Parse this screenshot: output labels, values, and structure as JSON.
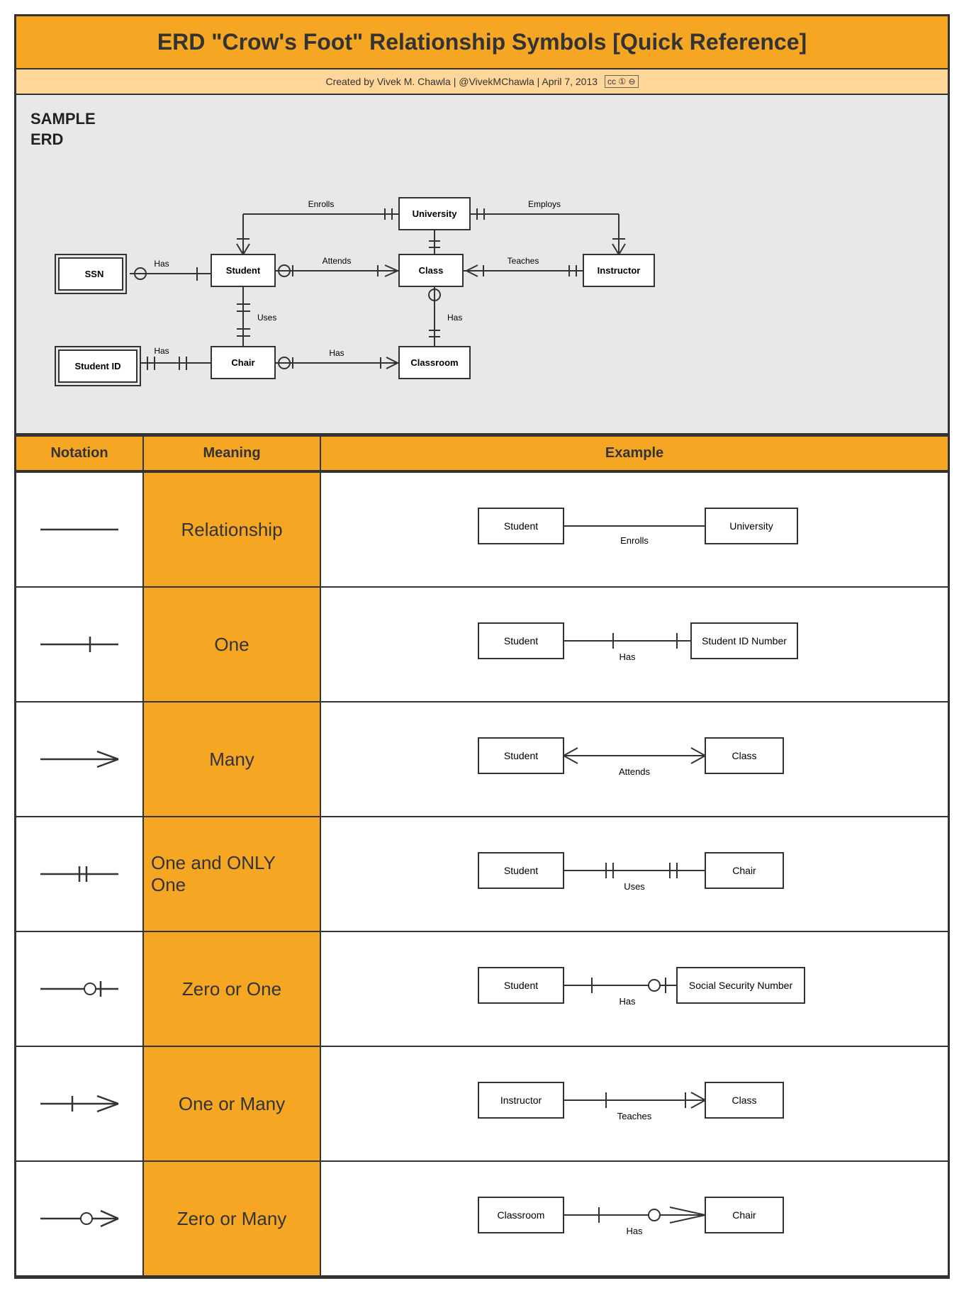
{
  "title": "ERD \"Crow's Foot\" Relationship Symbols [Quick Reference]",
  "credit": "Created by Vivek M. Chawla  |  @VivekMChawla  |  April 7, 2013",
  "erd_label": "SAMPLE\nERD",
  "header": {
    "notation": "Notation",
    "meaning": "Meaning",
    "example": "Example"
  },
  "rows": [
    {
      "meaning": "Relationship",
      "left_entity": "Student",
      "right_entity": "University",
      "rel_label": "Enrolls",
      "symbol": "plain"
    },
    {
      "meaning": "One",
      "left_entity": "Student",
      "right_entity": "Student ID Number",
      "rel_label": "Has",
      "symbol": "one"
    },
    {
      "meaning": "Many",
      "left_entity": "Student",
      "right_entity": "Class",
      "rel_label": "Attends",
      "symbol": "many"
    },
    {
      "meaning": "One and ONLY One",
      "left_entity": "Student",
      "right_entity": "Chair",
      "rel_label": "Uses",
      "symbol": "one-only"
    },
    {
      "meaning": "Zero or One",
      "left_entity": "Student",
      "right_entity": "Social Security Number",
      "rel_label": "Has",
      "symbol": "zero-one"
    },
    {
      "meaning": "One or Many",
      "left_entity": "Instructor",
      "right_entity": "Class",
      "rel_label": "Teaches",
      "symbol": "one-many"
    },
    {
      "meaning": "Zero or Many",
      "left_entity": "Classroom",
      "right_entity": "Chair",
      "rel_label": "Has",
      "symbol": "zero-many"
    }
  ]
}
